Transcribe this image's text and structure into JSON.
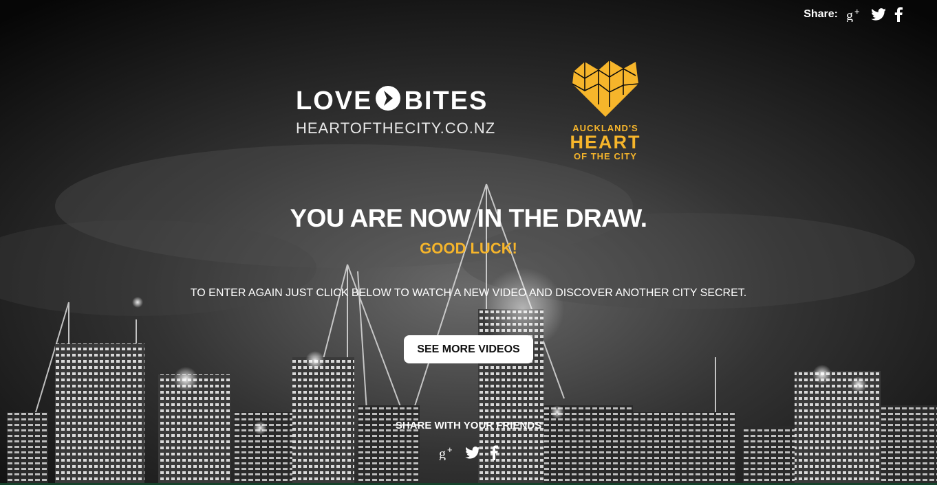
{
  "share_bar": {
    "label": "Share:",
    "icons": [
      "google-plus-icon",
      "twitter-icon",
      "facebook-icon"
    ]
  },
  "logos": {
    "lovebites": {
      "word1": "LOVE",
      "word2": "BITES",
      "url": "HEARTOFTHECITY.CO.NZ"
    },
    "heart_of_city": {
      "line1": "AUCKLAND'S",
      "line2": "HEART",
      "line3": "OF THE CITY"
    }
  },
  "main": {
    "headline": "YOU ARE NOW IN THE DRAW.",
    "subheadline": "GOOD LUCK!",
    "instructions": "TO ENTER AGAIN JUST CLICK BELOW TO WATCH A NEW VIDEO AND DISCOVER ANOTHER CITY SECRET.",
    "cta_label": "SEE MORE VIDEOS"
  },
  "share_friends": {
    "label": "SHARE WITH YOUR FRIENDS",
    "icons": [
      "google-plus-icon",
      "twitter-icon",
      "facebook-icon"
    ]
  },
  "colors": {
    "accent": "#f6b52b",
    "text": "#ffffff",
    "button_bg": "#ffffff",
    "button_text": "#111111",
    "bottom_bar": "#16442c"
  }
}
